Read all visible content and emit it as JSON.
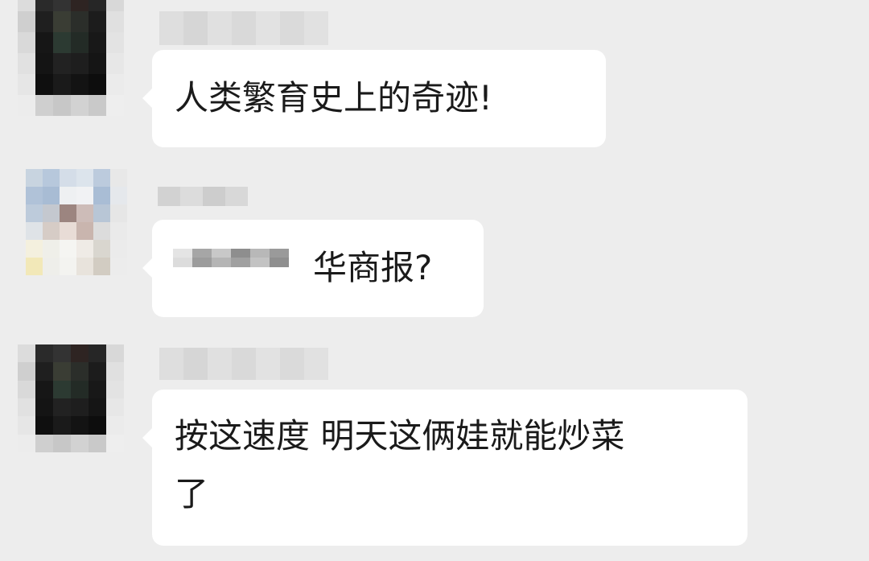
{
  "messages": [
    {
      "sender": "contact-1",
      "text": "人类繁育史上的奇迹!"
    },
    {
      "sender": "contact-2",
      "text": "华商报?"
    },
    {
      "sender": "contact-1",
      "text": "按这速度 明天这俩娃就能炒菜\n了"
    }
  ],
  "colors": {
    "background": "#ededed",
    "bubble": "#ffffff",
    "text": "#1a1a1a"
  }
}
